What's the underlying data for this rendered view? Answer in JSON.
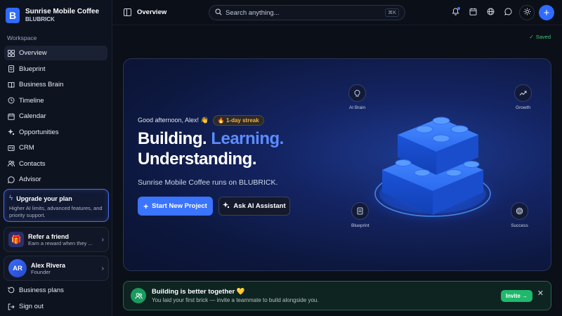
{
  "brand": {
    "name": "Sunrise Mobile Coffee",
    "org": "BLUBRICK",
    "logo_letter": "B"
  },
  "sidebar": {
    "section_label": "Workspace",
    "items": [
      {
        "label": "Overview",
        "icon": "grid-icon",
        "active": true
      },
      {
        "label": "Blueprint",
        "icon": "document-icon"
      },
      {
        "label": "Business Brain",
        "icon": "book-icon"
      },
      {
        "label": "Timeline",
        "icon": "history-icon"
      },
      {
        "label": "Calendar",
        "icon": "calendar-icon"
      },
      {
        "label": "Opportunities",
        "icon": "sparkle-icon"
      },
      {
        "label": "CRM",
        "icon": "crm-icon"
      },
      {
        "label": "Contacts",
        "icon": "people-icon"
      },
      {
        "label": "Advisor",
        "icon": "chat-icon"
      }
    ],
    "upgrade": {
      "title": "Upgrade your plan",
      "desc": "Higher AI limits, advanced features, and priority support."
    },
    "refer": {
      "title": "Refer a friend",
      "desc": "Earn a reward when they ..."
    },
    "user": {
      "initials": "AR",
      "name": "Alex Rivera",
      "role": "Founder"
    },
    "bottom_items": [
      {
        "label": "Business plans",
        "icon": "refresh-icon"
      },
      {
        "label": "Sign out",
        "icon": "signout-icon"
      }
    ]
  },
  "topbar": {
    "breadcrumb": "Overview",
    "search_placeholder": "Search anything...",
    "shortcut": "⌘K"
  },
  "status": {
    "saved": "Saved"
  },
  "hero": {
    "greeting": "Good afternoon, Alex! 👋",
    "streak": "🔥 1-day streak",
    "headline_part1": "Building.",
    "headline_part2": "Learning.",
    "headline_line2": "Understanding.",
    "subtitle": "Sunrise Mobile Coffee runs on BLUBRICK.",
    "primary_button": "Start New Project",
    "secondary_button": "Ask AI Assistant",
    "nodes": [
      {
        "label": "AI Brain",
        "icon": "brain-icon"
      },
      {
        "label": "Growth",
        "icon": "trend-up-icon"
      },
      {
        "label": "Blueprint",
        "icon": "document-icon"
      },
      {
        "label": "Success",
        "icon": "target-icon"
      }
    ]
  },
  "banner": {
    "title": "Building is better together 💛",
    "desc": "You laid your first brick — invite a teammate to build alongside you.",
    "button": "Invite →",
    "close": "✕"
  },
  "colors": {
    "accent": "#2f6bff",
    "success": "#1fb86c",
    "streak": "#f5b13c"
  }
}
